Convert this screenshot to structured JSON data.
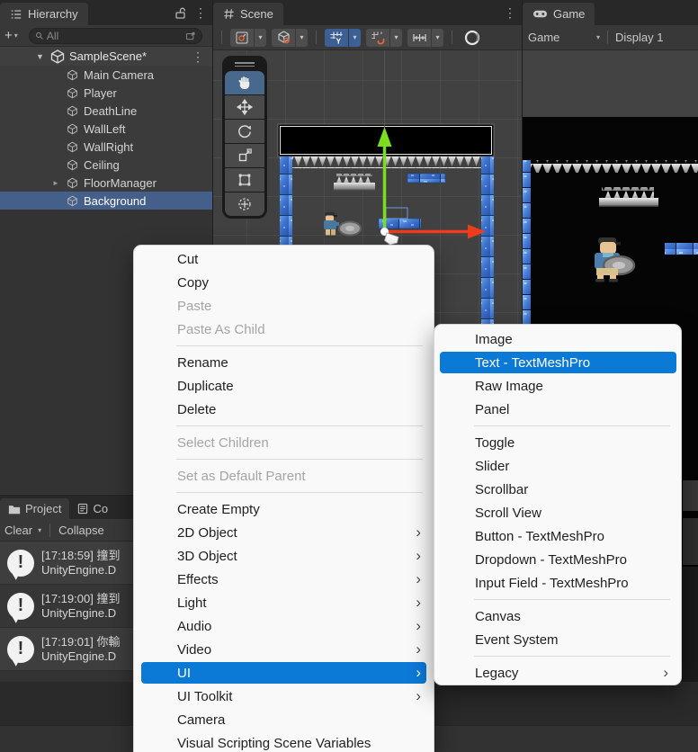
{
  "icons": {
    "add": "+",
    "dropdown": "▾",
    "kebab": "⋮",
    "foldout_open": "▼",
    "foldout_closed": "►",
    "chevron": "›",
    "exclamation": "!",
    "grid_axis": "Y"
  },
  "colors": {
    "selection_blue": "#44608a",
    "menu_highlight_blue": "#0b79d6",
    "gizmo_green": "#7ade1e",
    "gizmo_red": "#ef3c1c",
    "menu_bg": "#f9f9f9",
    "panel_bg": "#383838",
    "tabbar_bg": "#282828",
    "scene_bg": "#414141"
  },
  "hierarchy": {
    "tab": "Hierarchy",
    "search_placeholder": "All",
    "scene_name": "SampleScene*",
    "items": [
      {
        "label": "Main Camera"
      },
      {
        "label": "Player"
      },
      {
        "label": "DeathLine"
      },
      {
        "label": "WallLeft"
      },
      {
        "label": "WallRight"
      },
      {
        "label": "Ceiling"
      },
      {
        "label": "FloorManager",
        "foldout": true
      },
      {
        "label": "Background",
        "selected": true
      }
    ]
  },
  "scene_panel": {
    "tab": "Scene"
  },
  "game_panel": {
    "tab": "Game",
    "view_dropdown": "Game",
    "display_dropdown": "Display 1"
  },
  "console": {
    "tab_project": "Project",
    "tab_console": "Co",
    "clear": "Clear",
    "collapse": "Collapse",
    "logs": [
      {
        "line1": "[17:18:59] 撞到",
        "line2": "UnityEngine.D"
      },
      {
        "line1": "[17:19:00] 撞到",
        "line2": "UnityEngine.D"
      },
      {
        "line1": "[17:19:01] 你輸",
        "line2": "UnityEngine.D"
      }
    ]
  },
  "context_menu": {
    "items": [
      {
        "label": "Cut"
      },
      {
        "label": "Copy"
      },
      {
        "label": "Paste",
        "disabled": true
      },
      {
        "label": "Paste As Child",
        "disabled": true
      },
      {
        "separator": true
      },
      {
        "label": "Rename"
      },
      {
        "label": "Duplicate"
      },
      {
        "label": "Delete"
      },
      {
        "separator": true
      },
      {
        "label": "Select Children",
        "disabled": true
      },
      {
        "separator": true
      },
      {
        "label": "Set as Default Parent",
        "disabled": true
      },
      {
        "separator": true
      },
      {
        "label": "Create Empty"
      },
      {
        "label": "2D Object",
        "submenu": true
      },
      {
        "label": "3D Object",
        "submenu": true
      },
      {
        "label": "Effects",
        "submenu": true
      },
      {
        "label": "Light",
        "submenu": true
      },
      {
        "label": "Audio",
        "submenu": true
      },
      {
        "label": "Video",
        "submenu": true
      },
      {
        "label": "UI",
        "submenu": true,
        "highlighted": true
      },
      {
        "label": "UI Toolkit",
        "submenu": true
      },
      {
        "label": "Camera"
      },
      {
        "label": "Visual Scripting Scene Variables"
      }
    ]
  },
  "ui_submenu": {
    "items": [
      {
        "label": "Image"
      },
      {
        "label": "Text - TextMeshPro",
        "highlighted": true
      },
      {
        "label": "Raw Image"
      },
      {
        "label": "Panel"
      },
      {
        "separator": true
      },
      {
        "label": "Toggle"
      },
      {
        "label": "Slider"
      },
      {
        "label": "Scrollbar"
      },
      {
        "label": "Scroll View"
      },
      {
        "label": "Button - TextMeshPro"
      },
      {
        "label": "Dropdown - TextMeshPro"
      },
      {
        "label": "Input Field - TextMeshPro"
      },
      {
        "separator": true
      },
      {
        "label": "Canvas"
      },
      {
        "label": "Event System"
      },
      {
        "separator": true
      },
      {
        "label": "Legacy",
        "submenu": true
      }
    ]
  }
}
